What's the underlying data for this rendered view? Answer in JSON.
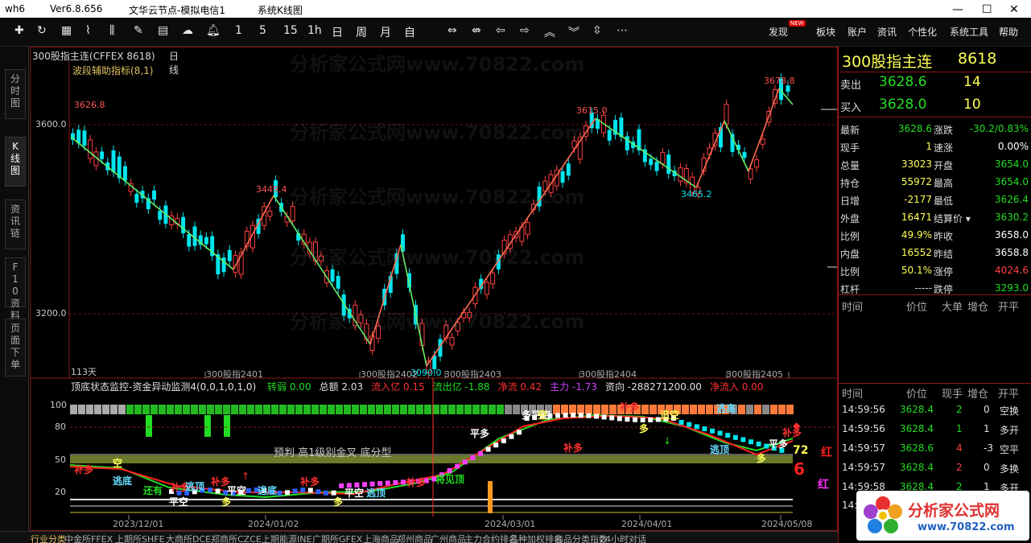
{
  "window": {
    "app": "wh6",
    "version": "Ver6.8.656",
    "server": "文华云节点-模拟电信1",
    "mode": "系统K线图",
    "min": "—",
    "max": "☐",
    "close": "✕"
  },
  "toolbar": {
    "items": [
      "1",
      "5",
      "15",
      "1h",
      "日",
      "周",
      "月",
      "自"
    ],
    "menus": [
      "发现",
      "板块",
      "账户",
      "资讯",
      "个性化",
      "系统工具",
      "帮助"
    ],
    "badge": "NEW"
  },
  "sidebar": {
    "tabs": [
      "分时图",
      "K线图",
      "资讯链",
      "F10资料",
      "页面下单"
    ]
  },
  "chart": {
    "header": {
      "contract": "300股指主连(CFFEX 8618)",
      "period": "日线",
      "indicator": "波段辅助指标(8,1)"
    },
    "yticks": [
      "3600.0",
      "3200.0"
    ],
    "price_labels": [
      "3626.8",
      "3449.4",
      "3615.0",
      "3678.8",
      "3465.2",
      "3090.0"
    ],
    "contract_marks": [
      "300股指2401",
      "300股指2402",
      "300股指2403",
      "300股指2404",
      "300股指2405"
    ],
    "days": "113天",
    "dates": [
      "2023/12/01",
      "2024/01/02",
      "2024/03/01",
      "2024/04/01",
      "2024/05/08"
    ]
  },
  "subchart": {
    "title": "顶底状态监控-资金异动监测4(0,0,1,0,1,0)",
    "stats": [
      {
        "label": "转弱",
        "value": "0.00",
        "color": "#22dd22"
      },
      {
        "label": "总额",
        "value": "2.03",
        "color": "#e0e0e0"
      },
      {
        "label": "流入亿",
        "value": "0.15",
        "color": "#ff3030"
      },
      {
        "label": "流出亿",
        "value": "-1.88",
        "color": "#22dd22"
      },
      {
        "label": "净流",
        "value": "0.42",
        "color": "#ff3030"
      },
      {
        "label": "主力",
        "value": "-1.73",
        "color": "#cc44ff"
      },
      {
        "label": "资向",
        "value": "-288271200.00",
        "color": "#e0e0e0"
      },
      {
        "label": "净流入",
        "value": "0.00",
        "color": "#ff3030"
      }
    ],
    "yticks": [
      "100",
      "80",
      "50",
      "20"
    ],
    "pattern_text": "预判  高1级别金叉  底分型",
    "right_value": "72",
    "right_red": "6",
    "side_text": [
      "红",
      "红"
    ],
    "marks": [
      "补多",
      "空",
      "逃底",
      "还有",
      "补多",
      "逃顶",
      "补多",
      "平空",
      "平空",
      "多",
      "逃底",
      "补多",
      "平空",
      "多",
      "逃顶",
      "补多",
      "将见顶",
      "平多",
      "多平空",
      "空",
      "补多",
      "多",
      "追空",
      "补多",
      "逃顶",
      "补多",
      "多",
      "平多",
      "逃高"
    ]
  },
  "quote": {
    "name": "300股指主连",
    "code": "8618",
    "sell": {
      "label": "卖出",
      "price": "3628.6",
      "vol": "14"
    },
    "buy": {
      "label": "买入",
      "price": "3628.0",
      "vol": "10"
    },
    "rows": [
      {
        "l1": "最新",
        "v1": "3628.6",
        "l2": "涨跌",
        "v2": "-30.2/0.83%"
      },
      {
        "l1": "现手",
        "v1": "1",
        "l2": "速涨",
        "v2": "0.00%"
      },
      {
        "l1": "总量",
        "v1": "33023",
        "l2": "开盘",
        "v2": "3654.0"
      },
      {
        "l1": "持仓",
        "v1": "55972",
        "l2": "最高",
        "v2": "3654.0"
      },
      {
        "l1": "日增",
        "v1": "-2177",
        "l2": "最低",
        "v2": "3626.4"
      },
      {
        "l1": "外盘",
        "v1": "16471",
        "l2": "结算价",
        "v2": "3630.2"
      },
      {
        "l1": "比例",
        "v1": "49.9%",
        "l2": "昨收",
        "v2": "3658.0"
      },
      {
        "l1": "内盘",
        "v1": "16552",
        "l2": "昨结",
        "v2": "3658.8"
      },
      {
        "l1": "比例",
        "v1": "50.1%",
        "l2": "涨停",
        "v2": "4024.6"
      },
      {
        "l1": "杠杆",
        "v1": "-----",
        "l2": "跌停",
        "v2": "3293.0"
      }
    ],
    "big_header": [
      "时间",
      "价位",
      "大单",
      "增仓",
      "开平"
    ],
    "trade_header": [
      "时间",
      "价位",
      "现手",
      "增仓",
      "开平"
    ],
    "trades": [
      {
        "t": "14:59:56",
        "p": "3628.4",
        "v": "2",
        "z": "0",
        "k": "空换"
      },
      {
        "t": "14:59:56",
        "p": "3628.4",
        "v": "1",
        "z": "1",
        "k": "多开"
      },
      {
        "t": "14:59:57",
        "p": "3628.6",
        "v": "4",
        "z": "-3",
        "k": "空平"
      },
      {
        "t": "14:59:57",
        "p": "3628.4",
        "v": "2",
        "z": "0",
        "k": "多换"
      },
      {
        "t": "14:59:58",
        "p": "3628.4",
        "v": "2",
        "z": "1",
        "k": "多开"
      }
    ],
    "trade_last": "14:5"
  },
  "bottom": {
    "tabs": [
      "行业分类",
      "中金所FFEX",
      "上期所SHFE",
      "大商所DCE",
      "郑商所CZCE",
      "上期能源INE",
      "广期所GFEX",
      "上海商品",
      "郑州商品",
      "广州商品",
      "主力合约排名",
      "品种加权排名",
      "商品分类指数",
      "24小时对话"
    ]
  },
  "logo": {
    "title": "分析家公式网",
    "url": "www.70822.com"
  },
  "watermark": "分析家公式网www.70822.com",
  "colors": {
    "up": "#ff4040",
    "down": "#00e5ee",
    "green": "#22dd22",
    "yellow": "#ffff55",
    "accent": "#ff8c00"
  }
}
